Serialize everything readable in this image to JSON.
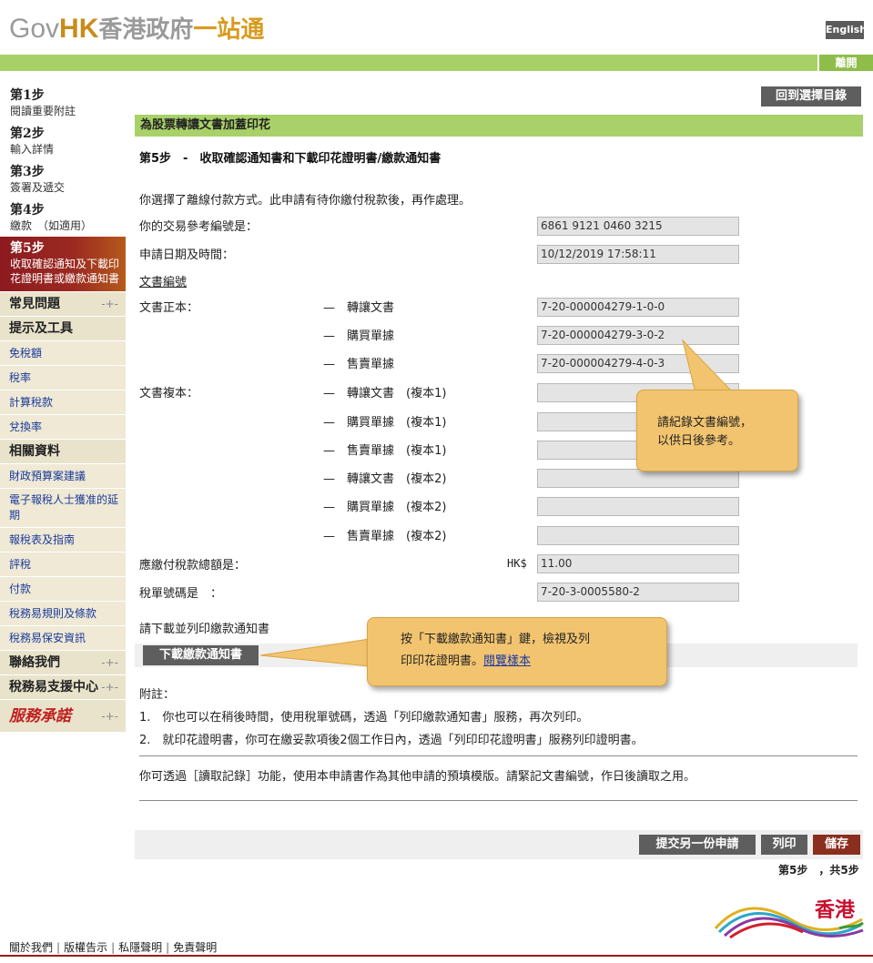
{
  "header": {
    "logo_gov": "Gov",
    "logo_hk": "HK",
    "logo_zh1": "香港政府",
    "logo_zh2": "一站通",
    "lang_label": "English",
    "logout_label": "離開"
  },
  "sidebar": {
    "steps": [
      {
        "title": "第1步",
        "desc": "閱讀重要附註"
      },
      {
        "title": "第2步",
        "desc": "輸入詳情"
      },
      {
        "title": "第3步",
        "desc": "簽署及遞交"
      },
      {
        "title": "第4步",
        "desc": "繳款　（如適用）"
      },
      {
        "title": "第5步",
        "desc": "收取確認通知及下載印花證明書或繳款通知書"
      }
    ],
    "faq": "常見問題",
    "tips": "提示及工具",
    "tools": [
      "免稅額",
      "稅率",
      "計算稅款",
      "兌換率"
    ],
    "related": "相關資料",
    "related_links": [
      "財政預算案建議",
      "電子報稅人士獲准的延期",
      "報稅表及指南",
      "評稅",
      "付款",
      "稅務易規則及條款",
      "稅務易保安資訊"
    ],
    "contact": "聯絡我們",
    "support": "稅務易支援中心",
    "slogan": "服務承諾"
  },
  "main": {
    "back_label": "回到選擇目錄",
    "section_title": "為股票轉讓文書加蓋印花",
    "step_heading": "第5步　-　收取確認通知書和下載印花證明書/繳款通知書",
    "intro": "你選擇了離線付款方式。此申請有待你繳付稅款後，再作處理。",
    "ref_label": "你的交易參考編號是：",
    "ref_value": "6861 9121 0460 3215",
    "datetime_label": "申請日期及時間：",
    "datetime_value": "10/12/2019 17:58:11",
    "doc_no_label": "文書編號",
    "original_label": "文書正本：",
    "original_items": [
      {
        "label": "—　轉讓文書",
        "value": "7-20-000004279-1-0-0"
      },
      {
        "label": "—　購買單據",
        "value": "7-20-000004279-3-0-2"
      },
      {
        "label": "—　售賣單據",
        "value": "7-20-000004279-4-0-3"
      }
    ],
    "copy_label": "文書複本：",
    "copy_items": [
      {
        "label": "—　轉讓文書　(複本1)",
        "value": ""
      },
      {
        "label": "—　購買單據　(複本1)",
        "value": ""
      },
      {
        "label": "—　售賣單據　(複本1)",
        "value": ""
      },
      {
        "label": "—　轉讓文書　(複本2)",
        "value": ""
      },
      {
        "label": "—　購買單據　(複本2)",
        "value": ""
      },
      {
        "label": "—　售賣單據　(複本2)",
        "value": ""
      }
    ],
    "total_label": "應繳付稅款總額是：",
    "currency": "HK$",
    "total_value": "11.00",
    "bill_label": "稅單號碼是　：",
    "bill_value": "7-20-3-0005580-2",
    "download_prompt": "請下載並列印繳款通知書",
    "download_label": "下載繳款通知書",
    "notes_title": "附註：",
    "notes": [
      "1.　你也可以在稍後時間，使用稅單號碼，透過「列印繳款通知書」服務，再次列印。",
      "2.　就印花證明書，你可在繳妥款項後2個工作日內，透過「列印印花證明書」服務列印證明書。"
    ],
    "read_record": "你可透過［讀取記錄］功能，使用本申請書作為其他申請的預填模版。請緊記文書編號，作日後讀取之用。",
    "submit_another": "提交另一份申請",
    "print_label": "列印",
    "save_label": "儲存",
    "page_indicator": "第5步　，共5步"
  },
  "callouts": {
    "doc_note_line1": "請紀錄文書編號，",
    "doc_note_line2": "以供日後參考。",
    "dl_note_line1": "按「下載繳款通知書」鍵，檢視及列",
    "dl_note_line2": "印印花證明書。",
    "dl_note_link": "閱覽樣本"
  },
  "footer": {
    "links": [
      "關於我們",
      "版權告示",
      "私隱聲明",
      "免責聲明"
    ],
    "brand": "香港"
  }
}
